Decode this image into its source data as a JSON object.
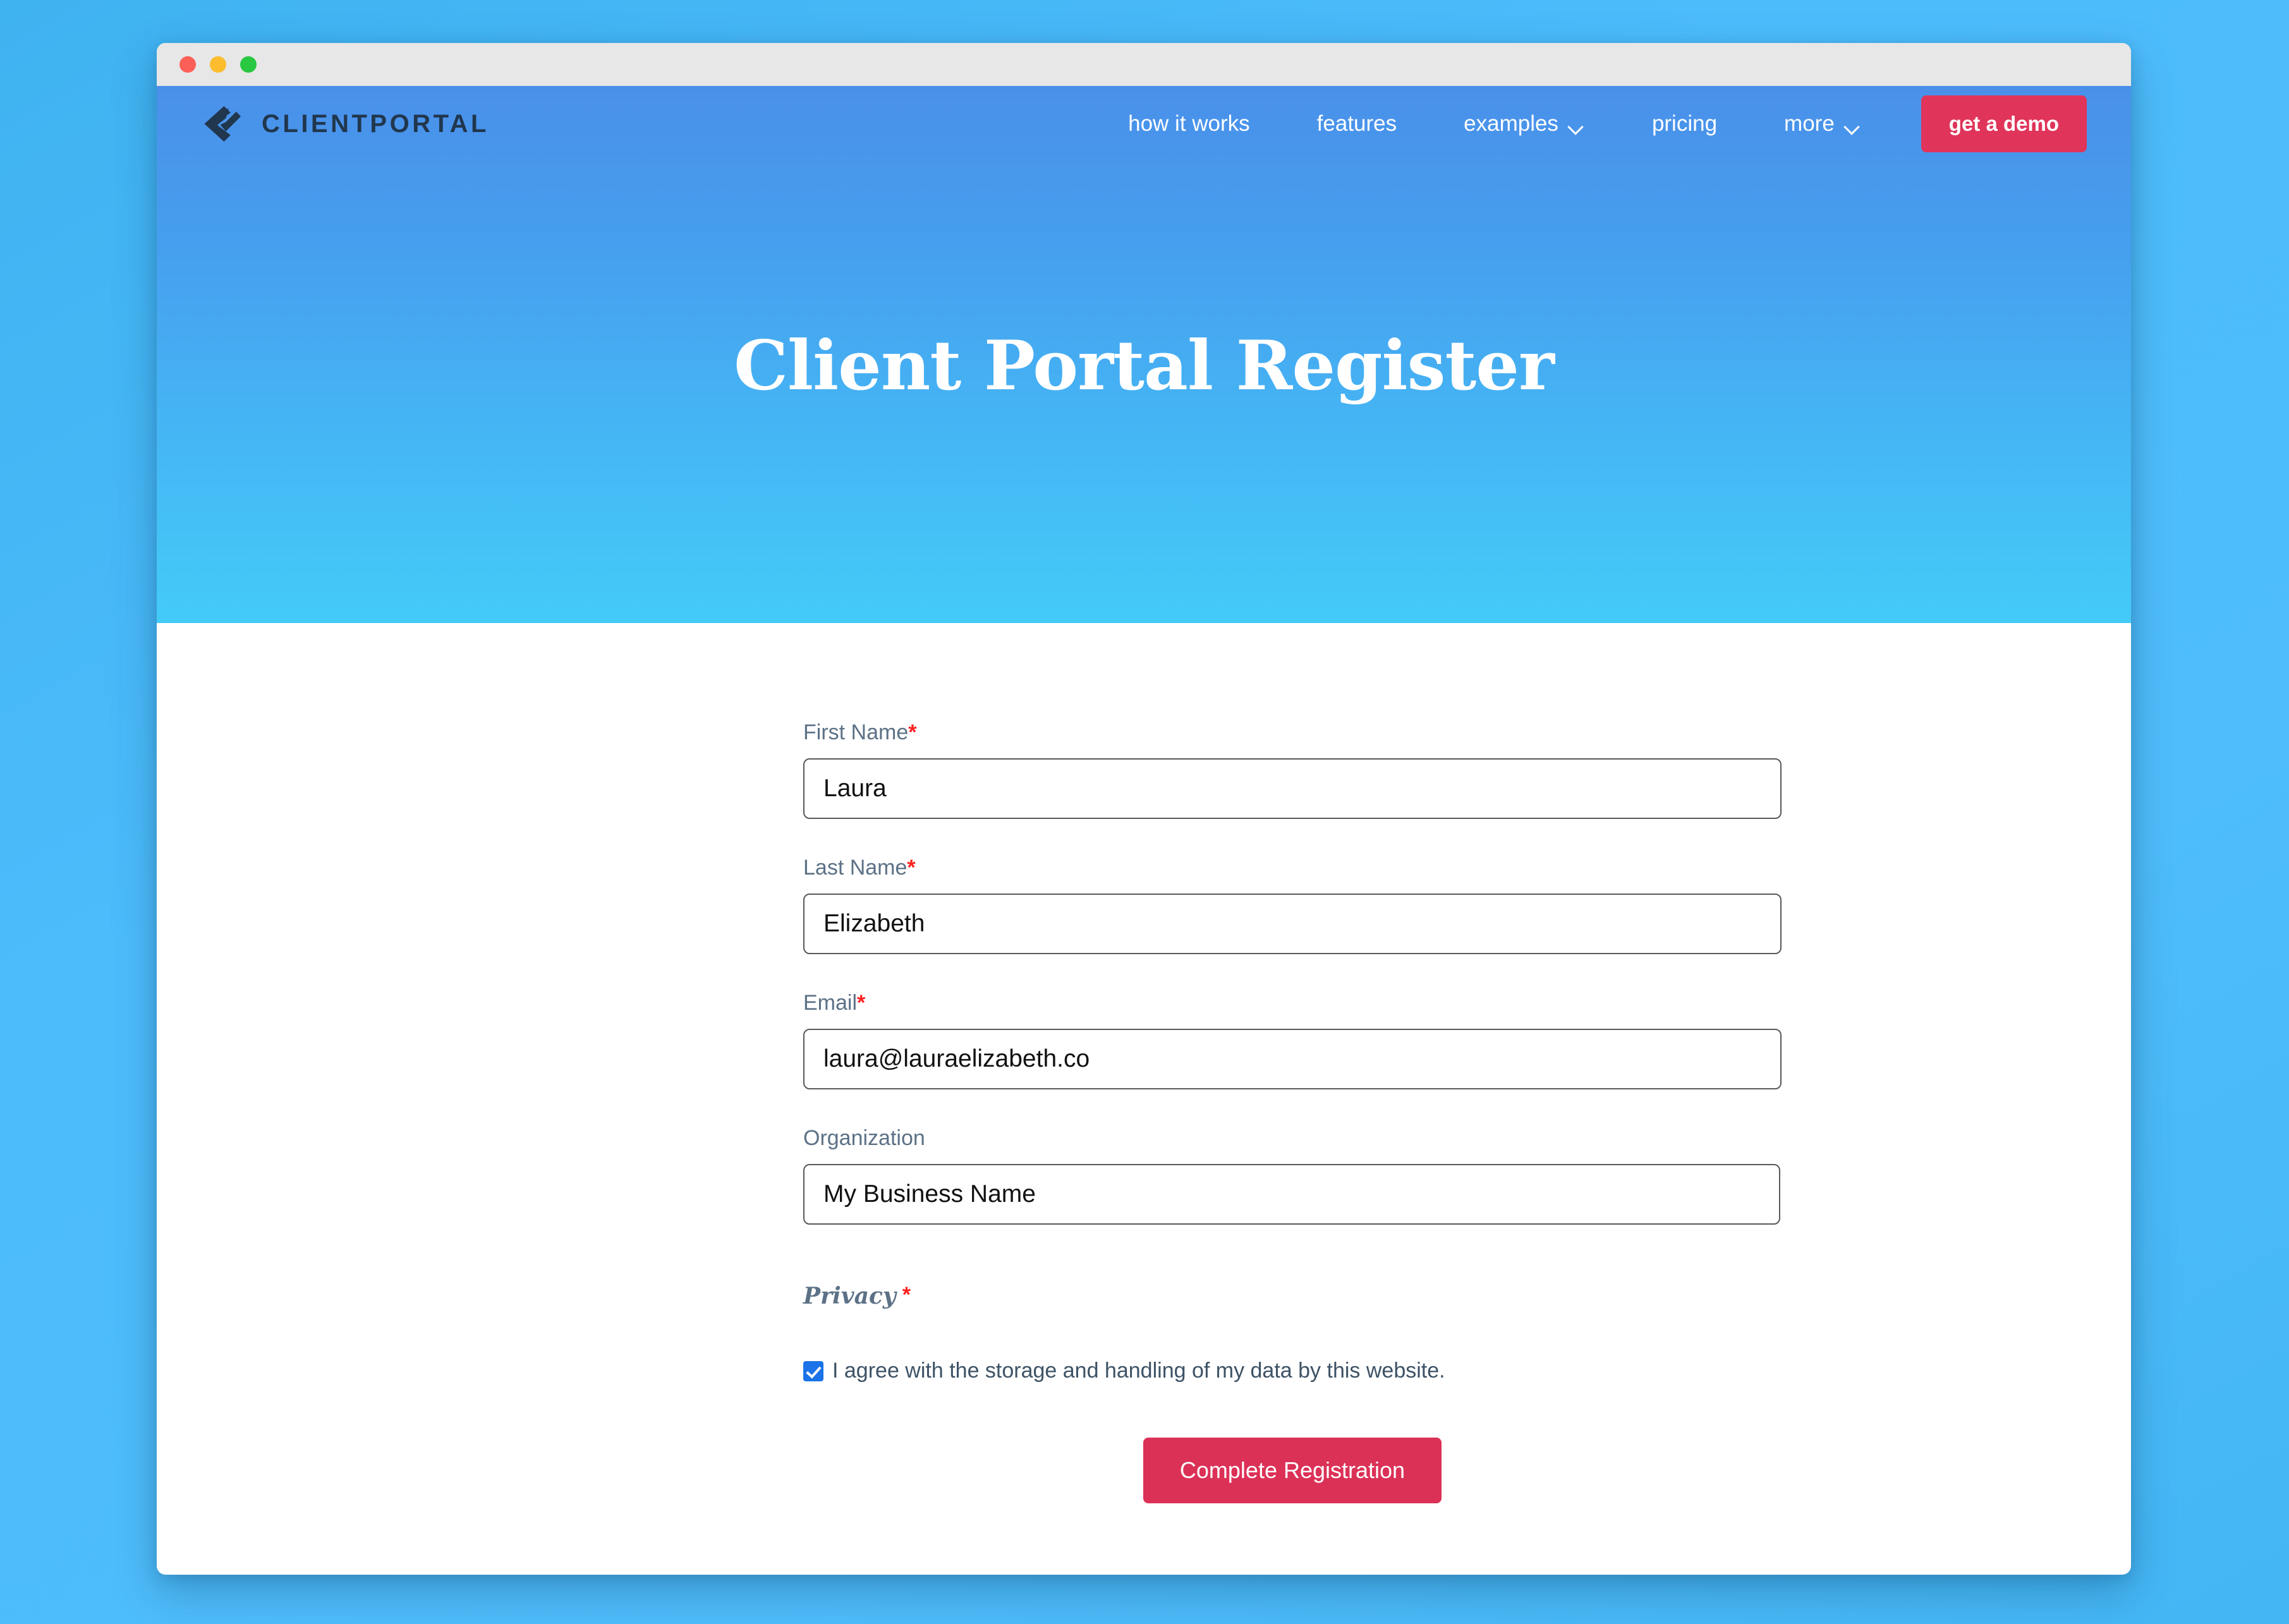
{
  "window": {
    "traffic_lights": [
      "close",
      "minimize",
      "maximize"
    ],
    "colors": {
      "close": "#fb5f57",
      "minimize": "#fbbd2e",
      "maximize": "#28c840",
      "titlebar": "#e7e7e7"
    }
  },
  "brand": {
    "name": "CLIENTPORTAL",
    "logo_icon": "clientportal-checkmark-logo",
    "logo_color": "#21374e"
  },
  "nav": {
    "items": [
      {
        "label": "how it works",
        "has_dropdown": false
      },
      {
        "label": "features",
        "has_dropdown": false
      },
      {
        "label": "examples",
        "has_dropdown": true
      },
      {
        "label": "pricing",
        "has_dropdown": false
      },
      {
        "label": "more",
        "has_dropdown": true
      }
    ],
    "cta": {
      "label": "get a demo",
      "color": "#e0345a"
    }
  },
  "hero": {
    "title": "Client Portal Register",
    "gradient_top": "#4a90ea",
    "gradient_bottom": "#44cbf8"
  },
  "form": {
    "fields": [
      {
        "label": "First Name",
        "required": true,
        "value": "Laura",
        "placeholder": "",
        "name": "first-name"
      },
      {
        "label": "Last Name",
        "required": true,
        "value": "Elizabeth",
        "placeholder": "",
        "name": "last-name"
      },
      {
        "label": "Email",
        "required": true,
        "value": "laura@lauraelizabeth.co",
        "placeholder": "",
        "name": "email"
      },
      {
        "label": "Organization",
        "required": false,
        "value": "My Business Name",
        "placeholder": "",
        "name": "organization"
      }
    ],
    "required_marker": "*",
    "privacy": {
      "heading": "Privacy",
      "required": true,
      "consent_label": "I agree with the storage and handling of my data by this website.",
      "consent_checked": true,
      "checkbox_color": "#1a73e8"
    },
    "submit": {
      "label": "Complete Registration",
      "color": "#dc3157"
    }
  },
  "page": {
    "background_color": "#4dbcfb",
    "content_background": "#ffffff"
  }
}
